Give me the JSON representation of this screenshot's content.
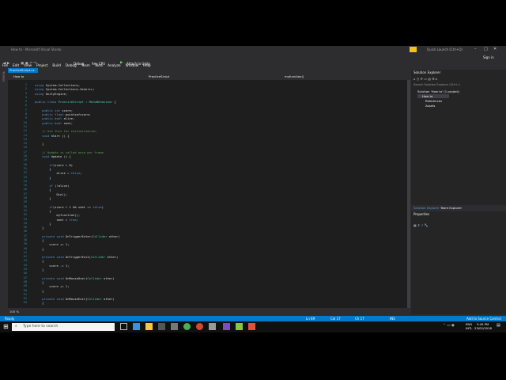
{
  "window": {
    "title": "How to - Microsoft Visual Studio"
  },
  "menu": [
    "File",
    "Edit",
    "View",
    "Project",
    "Build",
    "Debug",
    "Team",
    "Tools",
    "Analyze",
    "Window",
    "Help"
  ],
  "toolbar": {
    "config": "Debug",
    "platform": "Any CPU",
    "attach": "Attach to Unity"
  },
  "quick_launch": {
    "placeholder": "Quick Launch (Ctrl+Q)"
  },
  "signin": "Sign in",
  "tab": {
    "file": "PracticeScript.cs"
  },
  "navbar": {
    "project": "How to",
    "class": "PracticeScript",
    "member": "myfunction()"
  },
  "code_lines": [
    {
      "n": "1",
      "text": "using System.Collections;"
    },
    {
      "n": "2",
      "text": "using System.Collections.Generic;"
    },
    {
      "n": "3",
      "text": "using UnityEngine;"
    },
    {
      "n": "4",
      "text": ""
    },
    {
      "n": "5",
      "text": "public class PracticeScript : MonoBehaviour {"
    },
    {
      "n": "6",
      "text": ""
    },
    {
      "n": "7",
      "text": "    public int score;"
    },
    {
      "n": "8",
      "text": "    public float pointsofscore;"
    },
    {
      "n": "9",
      "text": "    public bool alive;"
    },
    {
      "n": "10",
      "text": "    public bool seet;"
    },
    {
      "n": "11",
      "text": ""
    },
    {
      "n": "12",
      "text": "    // Use this for initialization"
    },
    {
      "n": "13",
      "text": "    void Start () {"
    },
    {
      "n": "14",
      "text": ""
    },
    {
      "n": "15",
      "text": "    }"
    },
    {
      "n": "16",
      "text": ""
    },
    {
      "n": "17",
      "text": "    // Update is called once per frame"
    },
    {
      "n": "18",
      "text": "    void Update () {"
    },
    {
      "n": "19",
      "text": ""
    },
    {
      "n": "20",
      "text": "        if(score < 0)"
    },
    {
      "n": "21",
      "text": "        {"
    },
    {
      "n": "22",
      "text": "            alive = false;"
    },
    {
      "n": "23",
      "text": "        }"
    },
    {
      "n": "24",
      "text": ""
    },
    {
      "n": "25",
      "text": "        if (!alive)"
    },
    {
      "n": "26",
      "text": "        {"
    },
    {
      "n": "27",
      "text": "            Die();"
    },
    {
      "n": "28",
      "text": "        }"
    },
    {
      "n": "29",
      "text": ""
    },
    {
      "n": "30",
      "text": "        if(score > 1 && seet == false)"
    },
    {
      "n": "31",
      "text": "        {"
    },
    {
      "n": "32",
      "text": "            myfunction();"
    },
    {
      "n": "33",
      "text": "            seet = true;"
    },
    {
      "n": "34",
      "text": "        }"
    },
    {
      "n": "35",
      "text": "    }"
    },
    {
      "n": "36",
      "text": ""
    },
    {
      "n": "37",
      "text": "    private void OnTriggerEnter(Collider other)"
    },
    {
      "n": "38",
      "text": "    {"
    },
    {
      "n": "39",
      "text": "        score += 1;"
    },
    {
      "n": "40",
      "text": "    }"
    },
    {
      "n": "41",
      "text": ""
    },
    {
      "n": "42",
      "text": "    private void OnTriggerExit(Collider other)"
    },
    {
      "n": "43",
      "text": "    {"
    },
    {
      "n": "44",
      "text": "        score -= 1;"
    },
    {
      "n": "45",
      "text": "    }"
    },
    {
      "n": "46",
      "text": ""
    },
    {
      "n": "47",
      "text": "    private void OnMouseOver(Collider other)"
    },
    {
      "n": "48",
      "text": "    {"
    },
    {
      "n": "49",
      "text": "        score += 1;"
    },
    {
      "n": "50",
      "text": "    }"
    },
    {
      "n": "51",
      "text": ""
    },
    {
      "n": "52",
      "text": "    private void OnMouseExit(Collider other)"
    },
    {
      "n": "53",
      "text": "    {"
    }
  ],
  "zoom": "100 %",
  "solution_explorer": {
    "title": "Solution Explorer",
    "search_placeholder": "Search Solution Explorer (Ctrl+;)",
    "items": [
      "Solution 'How to' (1 project)",
      "How to",
      "References",
      "Assets"
    ],
    "tabs": [
      "Solution Explorer",
      "Team Explorer"
    ]
  },
  "properties": {
    "title": "Properties"
  },
  "status": {
    "left": "Ready",
    "ln": "Ln 69",
    "col": "Col 17",
    "ch": "Ch 17",
    "ins": "INS",
    "source": "Add to Source Control"
  },
  "taskbar": {
    "search_placeholder": "Type here to search",
    "lang": "ENG",
    "region": "INTL",
    "time": "5:45 PM",
    "date": "23/02/2018"
  },
  "colors": {
    "accent": "#007acc",
    "editor_bg": "#1e1e1e",
    "chrome": "#2d2d30"
  }
}
